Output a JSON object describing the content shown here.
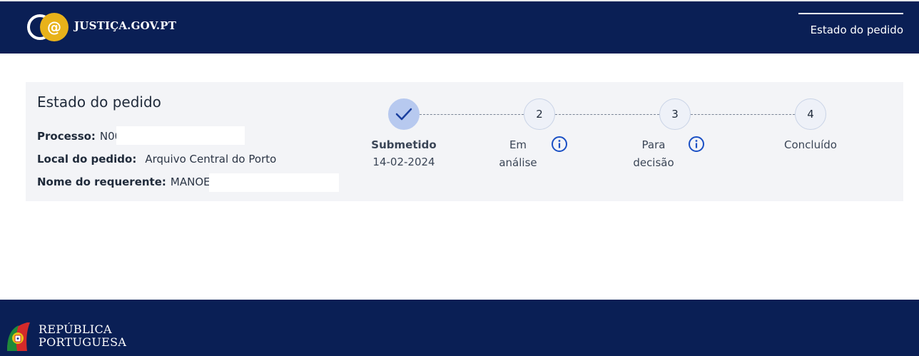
{
  "header": {
    "logo_text": "JUSTIÇA.GOV.PT",
    "nav_active": "Estado do pedido"
  },
  "card": {
    "title": "Estado do pedido",
    "processo_label": "Processo:",
    "processo_value": "N00",
    "local_label": "Local do pedido:",
    "local_value": "Arquivo Central do Porto",
    "nome_label": "Nome do requerente:",
    "nome_value": "MANOEL"
  },
  "stepper": {
    "steps": [
      {
        "number": "",
        "line1": "Submetido",
        "line2": "",
        "date": "14-02-2024",
        "status": "done",
        "icon": "check-icon"
      },
      {
        "number": "2",
        "line1": "Em",
        "line2": "análise",
        "date": "",
        "status": "pending",
        "icon": "info-icon"
      },
      {
        "number": "3",
        "line1": "Para",
        "line2": "decisão",
        "date": "",
        "status": "pending",
        "icon": "info-icon"
      },
      {
        "number": "4",
        "line1": "Concluído",
        "line2": "",
        "date": "",
        "status": "pending",
        "icon": ""
      }
    ]
  },
  "footer": {
    "rp_line1": "REPÚBLICA",
    "rp_line2": "PORTUGUESA"
  },
  "colors": {
    "navy": "#0a1f55",
    "gold": "#e8b21a",
    "step_done": "#b7c9ef",
    "info_blue": "#1a4fc4"
  }
}
